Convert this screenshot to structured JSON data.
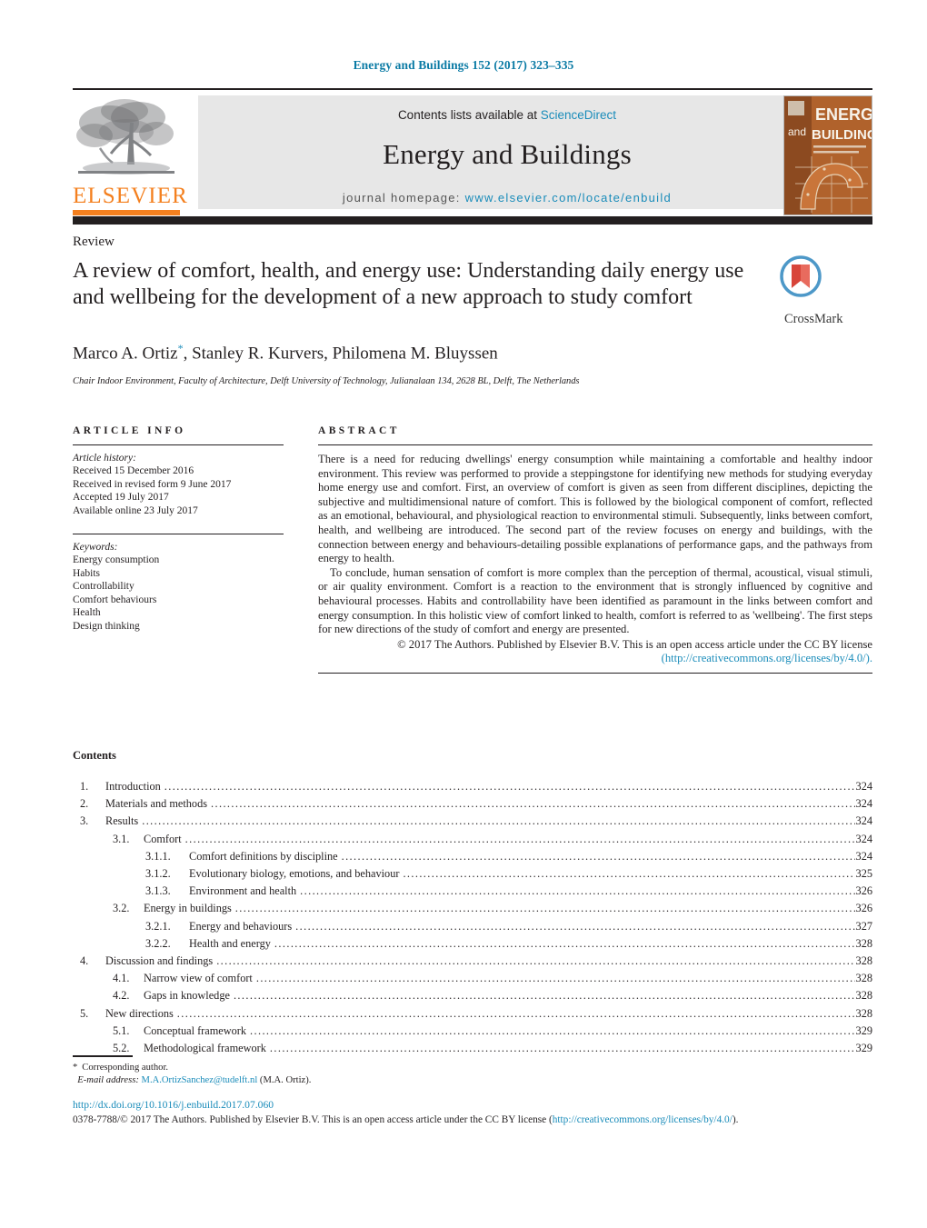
{
  "running_head": "Energy and Buildings 152 (2017) 323–335",
  "masthead": {
    "contents_prefix": "Contents lists available at ",
    "sciencedirect": "ScienceDirect",
    "journal_title": "Energy and Buildings",
    "homepage_prefix": "journal homepage: ",
    "homepage_url": "www.elsevier.com/locate/enbuild",
    "publisher_wordmark": "ELSEVIER",
    "cover_line1": "ENERGY",
    "cover_line2": "and",
    "cover_line3": "BUILDINGS",
    "accent_orange": "#f4801f",
    "link_blue": "#1a8cba",
    "band_gray": "#e7e7e7"
  },
  "article": {
    "doctype": "Review",
    "title": "A review of comfort, health, and energy use: Understanding daily energy use and wellbeing for the development of a new approach to study comfort",
    "authors": "Marco A. Ortiz",
    "authors_rest": ", Stanley R. Kurvers, Philomena M. Bluyssen",
    "author_marker": "*",
    "affiliation": "Chair Indoor Environment, Faculty of Architecture, Delft University of Technology, Julianalaan 134, 2628 BL, Delft, The Netherlands",
    "crossmark_label": "CrossMark"
  },
  "article_info": {
    "heading": "ARTICLE INFO",
    "history_label": "Article history:",
    "history": [
      "Received 15 December 2016",
      "Received in revised form 9 June 2017",
      "Accepted 19 July 2017",
      "Available online 23 July 2017"
    ],
    "keywords_label": "Keywords:",
    "keywords": [
      "Energy consumption",
      "Habits",
      "Controllability",
      "Comfort behaviours",
      "Health",
      "Design thinking"
    ]
  },
  "abstract": {
    "heading": "ABSTRACT",
    "paragraph1": "There is a need for reducing dwellings' energy consumption while maintaining a comfortable and healthy indoor environment. This review was performed to provide a steppingstone for identifying new methods for studying everyday home energy use and comfort. First, an overview of comfort is given as seen from different disciplines, depicting the subjective and multidimensional nature of comfort. This is followed by the biological component of comfort, reflected as an emotional, behavioural, and physiological reaction to environmental stimuli. Subsequently, links between comfort, health, and wellbeing are introduced. The second part of the review focuses on energy and buildings, with the connection between energy and behaviours-detailing possible explanations of performance gaps, and the pathways from energy to health.",
    "paragraph2": "To conclude, human sensation of comfort is more complex than the perception of thermal, acoustical, visual stimuli, or air quality environment. Comfort is a reaction to the environment that is strongly influenced by cognitive and behavioural processes. Habits and controllability have been identified as paramount in the links between comfort and energy consumption. In this holistic view of comfort linked to health, comfort is referred to as 'wellbeing'. The first steps for new directions of the study of comfort and energy are presented.",
    "copyright": "© 2017 The Authors. Published by Elsevier B.V. This is an open access article under the CC BY license",
    "license_link": "(http://creativecommons.org/licenses/by/4.0/)."
  },
  "contents": {
    "heading": "Contents",
    "rows": [
      {
        "level": 1,
        "num": "1.",
        "label": "Introduction",
        "page": "324"
      },
      {
        "level": 1,
        "num": "2.",
        "label": "Materials and methods",
        "page": "324"
      },
      {
        "level": 1,
        "num": "3.",
        "label": "Results",
        "page": "324"
      },
      {
        "level": 2,
        "num": "3.1.",
        "label": "Comfort",
        "page": "324"
      },
      {
        "level": 3,
        "num": "3.1.1.",
        "label": "Comfort definitions by discipline",
        "page": "324"
      },
      {
        "level": 3,
        "num": "3.1.2.",
        "label": "Evolutionary biology, emotions, and behaviour",
        "page": "325"
      },
      {
        "level": 3,
        "num": "3.1.3.",
        "label": "Environment and health",
        "page": "326"
      },
      {
        "level": 2,
        "num": "3.2.",
        "label": "Energy in buildings",
        "page": "326"
      },
      {
        "level": 3,
        "num": "3.2.1.",
        "label": "Energy and behaviours",
        "page": "327"
      },
      {
        "level": 3,
        "num": "3.2.2.",
        "label": "Health and energy",
        "page": "328"
      },
      {
        "level": 1,
        "num": "4.",
        "label": "Discussion and findings",
        "page": "328"
      },
      {
        "level": 2,
        "num": "4.1.",
        "label": "Narrow view of comfort",
        "page": "328"
      },
      {
        "level": 2,
        "num": "4.2.",
        "label": "Gaps in knowledge",
        "page": "328"
      },
      {
        "level": 1,
        "num": "5.",
        "label": "New directions",
        "page": "328"
      },
      {
        "level": 2,
        "num": "5.1.",
        "label": "Conceptual framework",
        "page": "329"
      },
      {
        "level": 2,
        "num": "5.2.",
        "label": "Methodological framework",
        "page": "329"
      }
    ]
  },
  "footer": {
    "corresponding_star": "*",
    "corresponding_label": "Corresponding author.",
    "email_label": "E-mail address:",
    "email": "M.A.OrtizSanchez@tudelft.nl",
    "email_suffix": "(M.A. Ortiz).",
    "doi": "http://dx.doi.org/10.1016/j.enbuild.2017.07.060",
    "issn_prefix": "0378-7788/© 2017 The Authors. Published by Elsevier B.V. This is an open access article under the CC BY license (",
    "issn_link": "http://creativecommons.org/licenses/by/4.0/",
    "issn_suffix": ")."
  }
}
